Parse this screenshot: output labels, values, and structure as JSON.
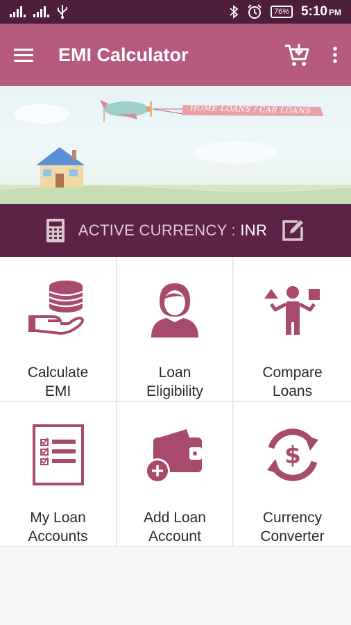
{
  "status_bar": {
    "battery": "76%",
    "time": "5:10",
    "time_suffix": "PM",
    "icons": [
      "signal-icon",
      "signal-icon",
      "usb-icon",
      "bluetooth-icon",
      "alarm-icon",
      "battery-icon"
    ]
  },
  "app_bar": {
    "title": "EMI Calculator",
    "menu_icon": "hamburger-menu-icon",
    "cart_icon": "add-to-cart-icon",
    "overflow_icon": "more-vert-icon"
  },
  "banner": {
    "sign_text": "HOME LOANS / CAR LOANS"
  },
  "currency": {
    "label": "ACTIVE CURRENCY : ",
    "value": "INR"
  },
  "tiles": [
    {
      "label": "Calculate\nEMI",
      "icon": "coins-hand-icon"
    },
    {
      "label": "Loan\nEligibility",
      "icon": "person-icon"
    },
    {
      "label": "Compare\nLoans",
      "icon": "compare-juggle-icon"
    },
    {
      "label": "My Loan\nAccounts",
      "icon": "checklist-icon"
    },
    {
      "label": "Add Loan\nAccount",
      "icon": "wallet-add-icon"
    },
    {
      "label": "Currency\nConverter",
      "icon": "currency-exchange-icon"
    }
  ],
  "colors": {
    "status_bar": "#4e1f3c",
    "app_bar": "#b55a7d",
    "currency_bar": "#5c2247",
    "icon": "#9c3a5f"
  }
}
